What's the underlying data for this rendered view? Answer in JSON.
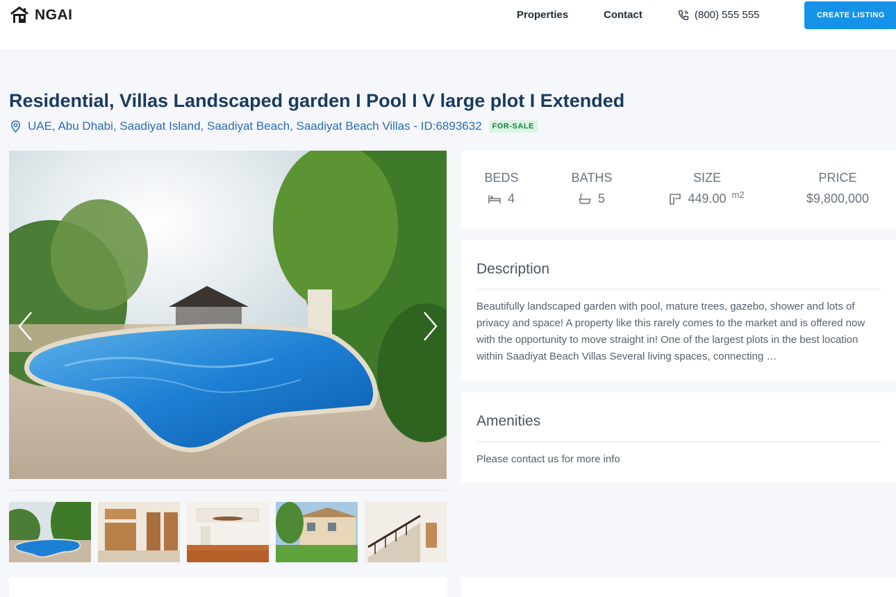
{
  "header": {
    "logo_text": "NGAI",
    "nav": {
      "properties": "Properties",
      "contact": "Contact"
    },
    "phone": "(800) 555 555",
    "create_listing": "CREATE LISTING"
  },
  "listing": {
    "title": "Residential, Villas Landscaped garden I Pool I V large plot I Extended",
    "address": "UAE, Abu Dhabi, Saadiyat Island, Saadiyat Beach, Saadiyat Beach Villas - ID:6893632",
    "status": "FOR-SALE"
  },
  "stats": {
    "beds_label": "BEDS",
    "beds": "4",
    "baths_label": "BATHS",
    "baths": "5",
    "size_label": "SIZE",
    "size": "449.00",
    "size_unit": "m2",
    "price_label": "PRICE",
    "price": "$9,800,000"
  },
  "description": {
    "title": "Description",
    "text": "Beautifully landscaped garden with pool, mature trees, gazebo, shower and lots of privacy and space! A property like this rarely comes to the market and is offered now with the opportunity to move straight in! One of the largest plots in the best location within Saadiyat Beach Villas Several living spaces, connecting …"
  },
  "amenities": {
    "title": "Amenities",
    "text": "Please contact us for more info"
  },
  "gallery": {
    "thumbnails": [
      "pool",
      "kitchen",
      "living-room",
      "exterior",
      "staircase"
    ]
  }
}
